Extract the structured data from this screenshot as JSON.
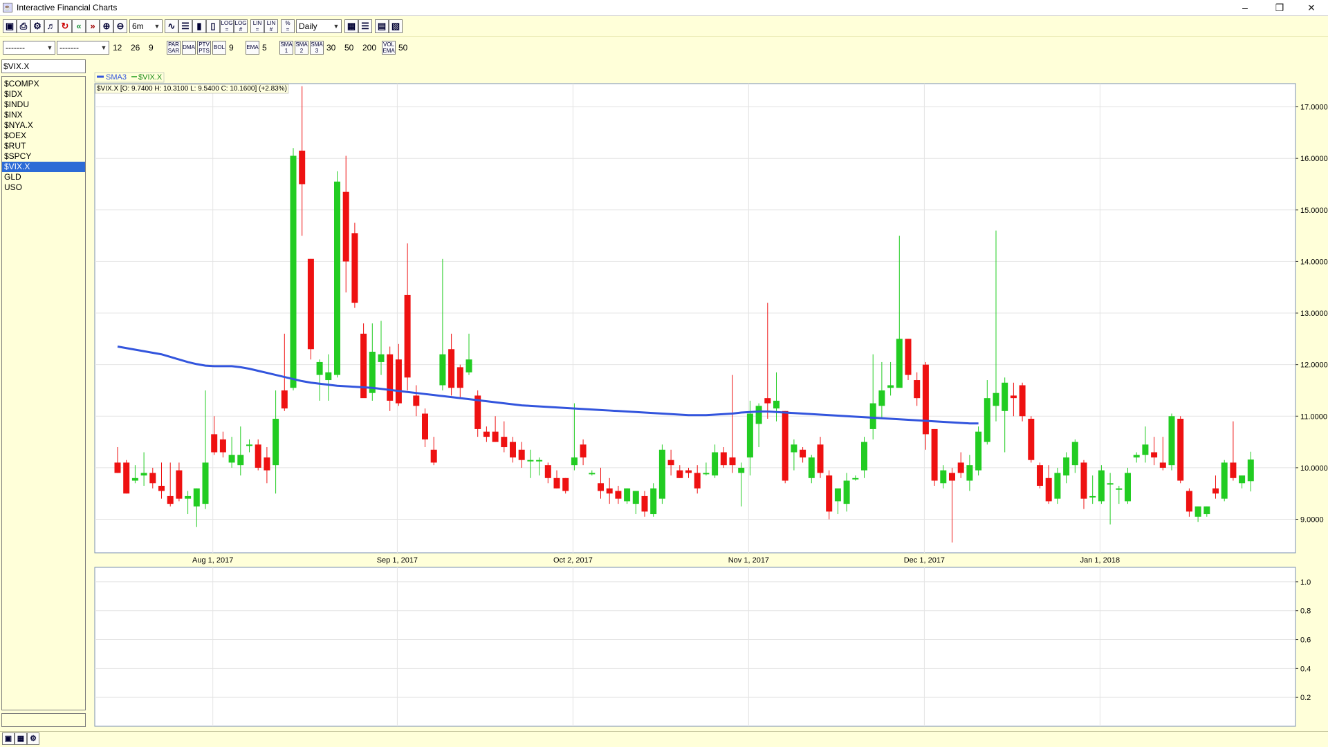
{
  "window": {
    "title": "Interactive Financial Charts",
    "minimize_glyph": "–",
    "restore_glyph": "❐",
    "close_glyph": "✕"
  },
  "toolbar": {
    "period": "6m",
    "interval": "Daily",
    "combo_a": "-------",
    "combo_b": "-------",
    "macd_fast": "12",
    "macd_slow": "26",
    "macd_signal": "9",
    "par_sar": "PAR\nSAR",
    "dma": "DMA",
    "ptv_pts": "PTV\nPTS",
    "bol": "BOL",
    "bol_period": "9",
    "ema": "EMA",
    "ema_period": "5",
    "sma1": "SMA\n1",
    "sma2": "SMA\n2",
    "sma3": "SMA\n3",
    "sma_p1": "30",
    "sma_p2": "50",
    "sma_p3": "200",
    "vol_ema": "VOL\nEMA",
    "vol_period": "50",
    "log1": "LOG\n=",
    "log2": "LOG\n#",
    "lin1": "LIN\n=",
    "lin2": "LIN\n#",
    "pct": "%\n="
  },
  "symbol_input": "$VIX.X",
  "symbols": [
    "$COMPX",
    "$IDX",
    "$INDU",
    "$INX",
    "$NYA.X",
    "$OEX",
    "$RUT",
    "$SPCY",
    "$VIX.X",
    "GLD",
    "USO"
  ],
  "selected_symbol": "$VIX.X",
  "colors": {
    "up": "#22cc22",
    "down": "#ee1111",
    "sma": "#3355dd",
    "grid": "#e4e4e4",
    "axis": "#7a8fb0"
  },
  "chart_data": {
    "type": "candlestick",
    "legend": [
      "SMA3",
      "$VIX.X"
    ],
    "info": "$VIX.X [O: 9.7400  H: 10.3100  L: 9.5400  C: 10.1600] (+2.83%)",
    "ylim": [
      8.35,
      17.45
    ],
    "y_ticks": [
      "9.0000",
      "10.0000",
      "11.0000",
      "12.0000",
      "13.0000",
      "14.0000",
      "15.0000",
      "16.0000",
      "17.0000"
    ],
    "y_tick_values": [
      9,
      10,
      11,
      12,
      13,
      14,
      15,
      16,
      17
    ],
    "x_labels": [
      "Aug 1, 2017",
      "Sep 1, 2017",
      "Oct 2, 2017",
      "Nov 1, 2017",
      "Dec 1, 2017",
      "Jan 1, 2018"
    ],
    "x_label_index": [
      11,
      32,
      52,
      72,
      92,
      112
    ],
    "lower_ylim": [
      0,
      1.1
    ],
    "lower_ticks": [
      "0.2",
      "0.4",
      "0.6",
      "0.8",
      "1.0"
    ],
    "lower_tick_values": [
      0.2,
      0.4,
      0.6,
      0.8,
      1.0
    ],
    "sma": [
      12.35,
      12.32,
      12.29,
      12.26,
      12.23,
      12.2,
      12.15,
      12.1,
      12.05,
      12.01,
      11.98,
      11.97,
      11.97,
      11.97,
      11.95,
      11.92,
      11.88,
      11.84,
      11.8,
      11.76,
      11.72,
      11.68,
      11.65,
      11.63,
      11.61,
      11.59,
      11.58,
      11.57,
      11.56,
      11.55,
      11.53,
      11.51,
      11.49,
      11.47,
      11.45,
      11.43,
      11.41,
      11.39,
      11.37,
      11.35,
      11.33,
      11.31,
      11.29,
      11.27,
      11.25,
      11.23,
      11.21,
      11.2,
      11.19,
      11.18,
      11.17,
      11.16,
      11.15,
      11.14,
      11.13,
      11.12,
      11.11,
      11.1,
      11.09,
      11.08,
      11.07,
      11.06,
      11.05,
      11.04,
      11.03,
      11.02,
      11.02,
      11.02,
      11.03,
      11.04,
      11.05,
      11.07,
      11.08,
      11.09,
      11.09,
      11.08,
      11.07,
      11.06,
      11.05,
      11.04,
      11.03,
      11.02,
      11.01,
      11.0,
      10.99,
      10.98,
      10.97,
      10.96,
      10.95,
      10.94,
      10.93,
      10.92,
      10.91,
      10.9,
      10.89,
      10.88,
      10.87,
      10.86,
      10.86
    ],
    "candles": [
      {
        "o": 10.1,
        "h": 10.4,
        "l": 9.9,
        "c": 9.9
      },
      {
        "o": 10.1,
        "h": 10.15,
        "l": 9.5,
        "c": 9.5
      },
      {
        "o": 9.75,
        "h": 10.05,
        "l": 9.7,
        "c": 9.8
      },
      {
        "o": 9.85,
        "h": 10.3,
        "l": 9.65,
        "c": 9.9
      },
      {
        "o": 9.9,
        "h": 10.0,
        "l": 9.6,
        "c": 9.7
      },
      {
        "o": 9.65,
        "h": 10.1,
        "l": 9.4,
        "c": 9.55
      },
      {
        "o": 9.45,
        "h": 10.1,
        "l": 9.25,
        "c": 9.3
      },
      {
        "o": 9.95,
        "h": 10.1,
        "l": 9.35,
        "c": 9.4
      },
      {
        "o": 9.4,
        "h": 9.55,
        "l": 9.1,
        "c": 9.45
      },
      {
        "o": 9.25,
        "h": 9.6,
        "l": 8.85,
        "c": 9.6
      },
      {
        "o": 9.3,
        "h": 11.5,
        "l": 9.2,
        "c": 10.1
      },
      {
        "o": 10.65,
        "h": 11.0,
        "l": 10.25,
        "c": 10.3
      },
      {
        "o": 10.55,
        "h": 10.7,
        "l": 10.2,
        "c": 10.3
      },
      {
        "o": 10.1,
        "h": 10.6,
        "l": 10.0,
        "c": 10.25
      },
      {
        "o": 10.05,
        "h": 10.8,
        "l": 9.85,
        "c": 10.25
      },
      {
        "o": 10.45,
        "h": 10.55,
        "l": 10.3,
        "c": 10.45
      },
      {
        "o": 10.45,
        "h": 10.55,
        "l": 9.95,
        "c": 10.0
      },
      {
        "o": 10.2,
        "h": 10.4,
        "l": 9.7,
        "c": 9.95
      },
      {
        "o": 10.05,
        "h": 11.5,
        "l": 9.5,
        "c": 10.95
      },
      {
        "o": 11.5,
        "h": 12.6,
        "l": 11.1,
        "c": 11.15
      },
      {
        "o": 11.55,
        "h": 16.2,
        "l": 11.5,
        "c": 16.05
      },
      {
        "o": 16.15,
        "h": 17.4,
        "l": 14.5,
        "c": 15.5
      },
      {
        "o": 14.05,
        "h": 14.05,
        "l": 12.1,
        "c": 12.3
      },
      {
        "o": 11.8,
        "h": 12.1,
        "l": 11.3,
        "c": 12.05
      },
      {
        "o": 11.7,
        "h": 12.2,
        "l": 11.3,
        "c": 11.85
      },
      {
        "o": 11.8,
        "h": 15.75,
        "l": 11.75,
        "c": 15.55
      },
      {
        "o": 15.35,
        "h": 16.05,
        "l": 13.4,
        "c": 14.0
      },
      {
        "o": 14.55,
        "h": 14.75,
        "l": 13.1,
        "c": 13.2
      },
      {
        "o": 12.6,
        "h": 12.8,
        "l": 11.4,
        "c": 11.35
      },
      {
        "o": 11.45,
        "h": 12.8,
        "l": 11.3,
        "c": 12.25
      },
      {
        "o": 12.05,
        "h": 12.85,
        "l": 11.8,
        "c": 12.2
      },
      {
        "o": 12.2,
        "h": 12.35,
        "l": 11.1,
        "c": 11.3
      },
      {
        "o": 12.1,
        "h": 12.4,
        "l": 11.2,
        "c": 11.25
      },
      {
        "o": 13.35,
        "h": 14.35,
        "l": 11.5,
        "c": 11.75
      },
      {
        "o": 11.4,
        "h": 11.6,
        "l": 11.0,
        "c": 11.2
      },
      {
        "o": 11.05,
        "h": 11.15,
        "l": 10.4,
        "c": 10.55
      },
      {
        "o": 10.35,
        "h": 10.6,
        "l": 10.05,
        "c": 10.1
      },
      {
        "o": 11.6,
        "h": 14.05,
        "l": 11.5,
        "c": 12.2
      },
      {
        "o": 12.3,
        "h": 12.6,
        "l": 11.4,
        "c": 11.55
      },
      {
        "o": 11.95,
        "h": 12.0,
        "l": 11.35,
        "c": 11.55
      },
      {
        "o": 11.85,
        "h": 12.6,
        "l": 11.8,
        "c": 12.1
      },
      {
        "o": 11.4,
        "h": 11.5,
        "l": 10.6,
        "c": 10.75
      },
      {
        "o": 10.7,
        "h": 10.8,
        "l": 10.5,
        "c": 10.6
      },
      {
        "o": 10.7,
        "h": 11.0,
        "l": 10.5,
        "c": 10.5
      },
      {
        "o": 10.6,
        "h": 10.9,
        "l": 10.3,
        "c": 10.4
      },
      {
        "o": 10.5,
        "h": 10.6,
        "l": 10.1,
        "c": 10.2
      },
      {
        "o": 10.35,
        "h": 10.5,
        "l": 10.0,
        "c": 10.15
      },
      {
        "o": 10.15,
        "h": 10.35,
        "l": 9.8,
        "c": 10.15
      },
      {
        "o": 10.15,
        "h": 10.2,
        "l": 9.85,
        "c": 10.15
      },
      {
        "o": 10.05,
        "h": 10.1,
        "l": 9.7,
        "c": 9.8
      },
      {
        "o": 9.8,
        "h": 9.95,
        "l": 9.6,
        "c": 9.6
      },
      {
        "o": 9.8,
        "h": 9.8,
        "l": 9.5,
        "c": 9.55
      },
      {
        "o": 10.05,
        "h": 11.25,
        "l": 9.95,
        "c": 10.2
      },
      {
        "o": 10.45,
        "h": 10.55,
        "l": 10.05,
        "c": 10.2
      },
      {
        "o": 9.9,
        "h": 9.95,
        "l": 9.85,
        "c": 9.9
      },
      {
        "o": 9.7,
        "h": 10.0,
        "l": 9.4,
        "c": 9.55
      },
      {
        "o": 9.6,
        "h": 9.8,
        "l": 9.3,
        "c": 9.5
      },
      {
        "o": 9.55,
        "h": 9.65,
        "l": 9.3,
        "c": 9.4
      },
      {
        "o": 9.35,
        "h": 9.6,
        "l": 9.3,
        "c": 9.6
      },
      {
        "o": 9.3,
        "h": 9.35,
        "l": 9.1,
        "c": 9.55
      },
      {
        "o": 9.45,
        "h": 9.55,
        "l": 9.05,
        "c": 9.15
      },
      {
        "o": 9.1,
        "h": 9.7,
        "l": 9.05,
        "c": 9.6
      },
      {
        "o": 9.4,
        "h": 10.45,
        "l": 9.3,
        "c": 10.35
      },
      {
        "o": 10.15,
        "h": 10.35,
        "l": 9.85,
        "c": 10.05
      },
      {
        "o": 9.95,
        "h": 10.05,
        "l": 9.8,
        "c": 9.8
      },
      {
        "o": 9.95,
        "h": 10.0,
        "l": 9.8,
        "c": 9.9
      },
      {
        "o": 9.9,
        "h": 10.05,
        "l": 9.5,
        "c": 9.6
      },
      {
        "o": 9.9,
        "h": 10.1,
        "l": 9.85,
        "c": 9.9
      },
      {
        "o": 9.85,
        "h": 10.45,
        "l": 9.8,
        "c": 10.3
      },
      {
        "o": 10.3,
        "h": 10.4,
        "l": 10.0,
        "c": 10.05
      },
      {
        "o": 10.2,
        "h": 11.8,
        "l": 9.9,
        "c": 10.05
      },
      {
        "o": 9.9,
        "h": 10.1,
        "l": 9.25,
        "c": 10.0
      },
      {
        "o": 10.2,
        "h": 11.3,
        "l": 9.85,
        "c": 11.05
      },
      {
        "o": 10.85,
        "h": 11.25,
        "l": 10.4,
        "c": 11.2
      },
      {
        "o": 11.35,
        "h": 13.2,
        "l": 10.95,
        "c": 11.25
      },
      {
        "o": 11.15,
        "h": 11.85,
        "l": 10.9,
        "c": 11.3
      },
      {
        "o": 11.1,
        "h": 11.1,
        "l": 9.7,
        "c": 9.75
      },
      {
        "o": 10.3,
        "h": 10.55,
        "l": 9.95,
        "c": 10.45
      },
      {
        "o": 10.35,
        "h": 10.4,
        "l": 10.1,
        "c": 10.2
      },
      {
        "o": 9.8,
        "h": 10.25,
        "l": 9.7,
        "c": 10.2
      },
      {
        "o": 10.45,
        "h": 10.6,
        "l": 9.8,
        "c": 9.9
      },
      {
        "o": 9.85,
        "h": 9.95,
        "l": 9.0,
        "c": 9.15
      },
      {
        "o": 9.35,
        "h": 9.5,
        "l": 9.1,
        "c": 9.6
      },
      {
        "o": 9.3,
        "h": 9.9,
        "l": 9.15,
        "c": 9.75
      },
      {
        "o": 9.8,
        "h": 9.85,
        "l": 9.75,
        "c": 9.8
      },
      {
        "o": 9.95,
        "h": 10.6,
        "l": 9.8,
        "c": 10.5
      },
      {
        "o": 10.75,
        "h": 12.2,
        "l": 10.55,
        "c": 11.25
      },
      {
        "o": 11.2,
        "h": 12.05,
        "l": 10.95,
        "c": 11.5
      },
      {
        "o": 11.55,
        "h": 12.05,
        "l": 11.4,
        "c": 11.6
      },
      {
        "o": 11.55,
        "h": 14.5,
        "l": 12.3,
        "c": 12.5
      },
      {
        "o": 12.5,
        "h": 12.5,
        "l": 11.7,
        "c": 11.8
      },
      {
        "o": 11.7,
        "h": 11.85,
        "l": 11.2,
        "c": 11.35
      },
      {
        "o": 12.0,
        "h": 12.05,
        "l": 10.35,
        "c": 10.65
      },
      {
        "o": 10.75,
        "h": 10.75,
        "l": 9.65,
        "c": 9.75
      },
      {
        "o": 9.7,
        "h": 10.05,
        "l": 9.6,
        "c": 9.95
      },
      {
        "o": 9.9,
        "h": 10.0,
        "l": 8.55,
        "c": 9.75
      },
      {
        "o": 10.1,
        "h": 10.3,
        "l": 9.8,
        "c": 9.9
      },
      {
        "o": 9.75,
        "h": 10.25,
        "l": 9.55,
        "c": 10.05
      },
      {
        "o": 9.95,
        "h": 10.8,
        "l": 9.85,
        "c": 10.7
      },
      {
        "o": 10.5,
        "h": 11.7,
        "l": 10.45,
        "c": 11.35
      },
      {
        "o": 11.2,
        "h": 14.6,
        "l": 10.9,
        "c": 11.45
      },
      {
        "o": 11.1,
        "h": 11.75,
        "l": 10.3,
        "c": 11.65
      },
      {
        "o": 11.4,
        "h": 11.65,
        "l": 11.0,
        "c": 11.35
      },
      {
        "o": 11.6,
        "h": 11.65,
        "l": 10.9,
        "c": 11.0
      },
      {
        "o": 10.95,
        "h": 11.0,
        "l": 10.1,
        "c": 10.15
      },
      {
        "o": 10.05,
        "h": 10.1,
        "l": 9.6,
        "c": 9.65
      },
      {
        "o": 9.8,
        "h": 10.05,
        "l": 9.3,
        "c": 9.35
      },
      {
        "o": 9.4,
        "h": 10.0,
        "l": 9.3,
        "c": 9.9
      },
      {
        "o": 9.85,
        "h": 10.3,
        "l": 9.7,
        "c": 10.2
      },
      {
        "o": 10.05,
        "h": 10.55,
        "l": 9.9,
        "c": 10.5
      },
      {
        "o": 10.1,
        "h": 10.15,
        "l": 9.2,
        "c": 9.4
      },
      {
        "o": 9.45,
        "h": 9.85,
        "l": 9.3,
        "c": 9.45
      },
      {
        "o": 9.35,
        "h": 10.05,
        "l": 9.3,
        "c": 9.95
      },
      {
        "o": 9.7,
        "h": 9.9,
        "l": 8.9,
        "c": 9.7
      },
      {
        "o": 9.6,
        "h": 9.65,
        "l": 9.3,
        "c": 9.6
      },
      {
        "o": 9.35,
        "h": 10.0,
        "l": 9.3,
        "c": 9.9
      },
      {
        "o": 10.2,
        "h": 10.3,
        "l": 10.1,
        "c": 10.25
      },
      {
        "o": 10.25,
        "h": 10.8,
        "l": 10.1,
        "c": 10.45
      },
      {
        "o": 10.3,
        "h": 10.6,
        "l": 10.05,
        "c": 10.2
      },
      {
        "o": 10.1,
        "h": 10.6,
        "l": 9.95,
        "c": 10.0
      },
      {
        "o": 10.05,
        "h": 11.05,
        "l": 9.95,
        "c": 11.0
      },
      {
        "o": 10.95,
        "h": 11.0,
        "l": 9.7,
        "c": 9.75
      },
      {
        "o": 9.55,
        "h": 9.6,
        "l": 9.05,
        "c": 9.15
      },
      {
        "o": 9.05,
        "h": 9.25,
        "l": 8.95,
        "c": 9.25
      },
      {
        "o": 9.1,
        "h": 9.25,
        "l": 9.05,
        "c": 9.25
      },
      {
        "o": 9.6,
        "h": 9.85,
        "l": 9.4,
        "c": 9.5
      },
      {
        "o": 9.4,
        "h": 10.15,
        "l": 9.35,
        "c": 10.1
      },
      {
        "o": 10.1,
        "h": 10.9,
        "l": 9.75,
        "c": 9.8
      },
      {
        "o": 9.7,
        "h": 9.85,
        "l": 9.6,
        "c": 9.85
      },
      {
        "o": 9.74,
        "h": 10.31,
        "l": 9.54,
        "c": 10.16
      }
    ]
  }
}
